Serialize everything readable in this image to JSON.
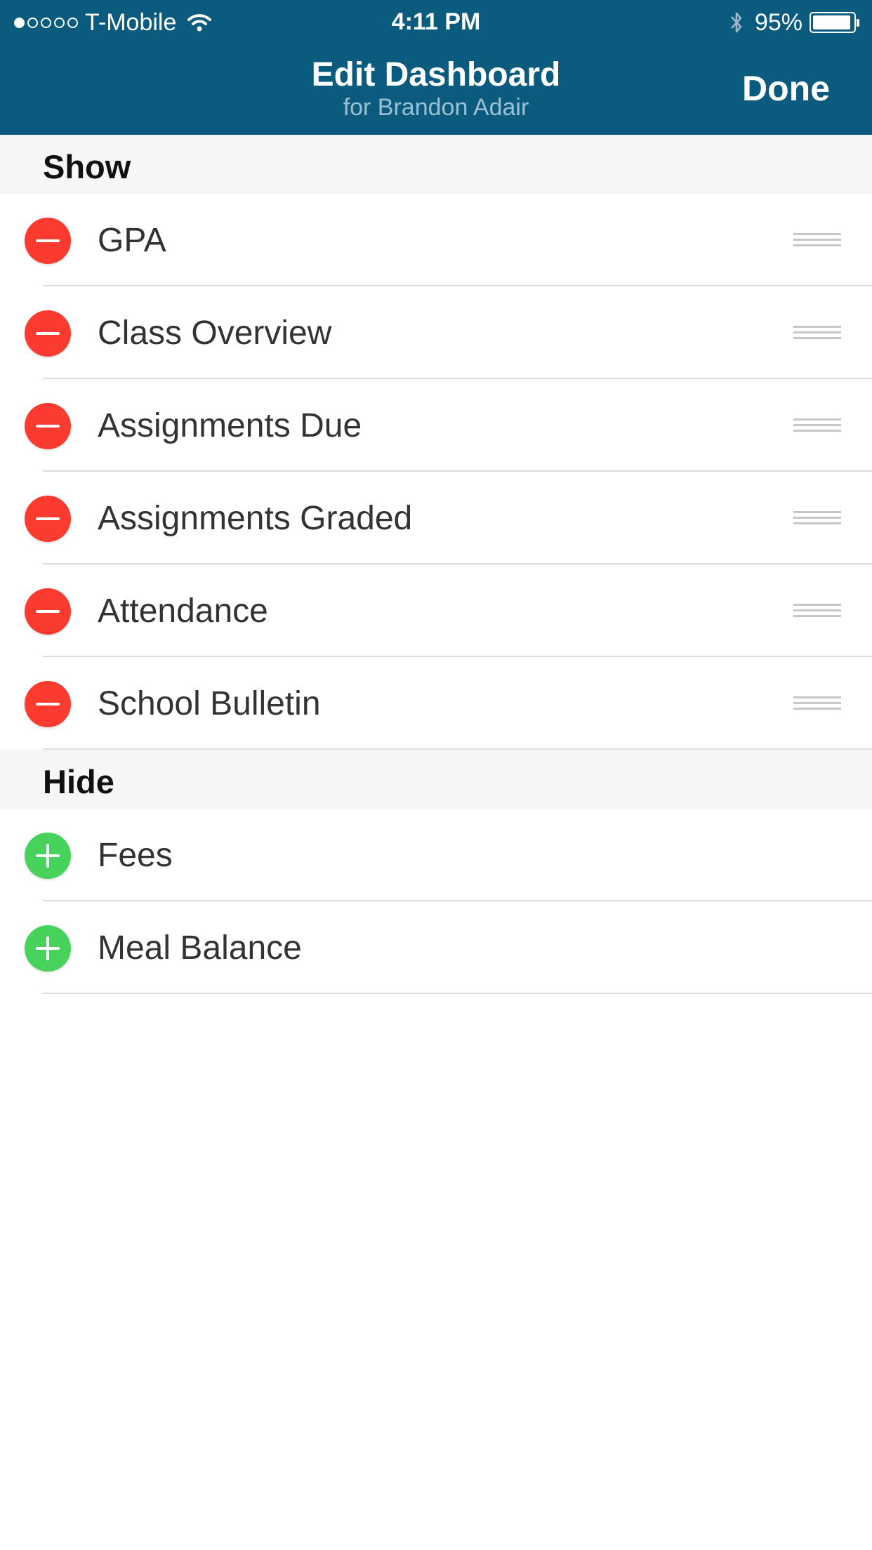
{
  "status_bar": {
    "signal_dots": [
      true,
      false,
      false,
      false,
      false
    ],
    "carrier": "T-Mobile",
    "wifi_icon": "wifi-icon",
    "time": "4:11 PM",
    "bluetooth_icon": "bluetooth-icon",
    "battery_percent": "95%",
    "battery_level": 0.95
  },
  "nav": {
    "title": "Edit Dashboard",
    "subtitle": "for Brandon Adair",
    "done_label": "Done"
  },
  "sections": {
    "show": {
      "title": "Show",
      "items": [
        "GPA",
        "Class Overview",
        "Assignments Due",
        "Assignments Graded",
        "Attendance",
        "School Bulletin"
      ]
    },
    "hide": {
      "title": "Hide",
      "items": [
        "Fees",
        "Meal Balance"
      ]
    }
  },
  "colors": {
    "nav_background": "#0a5b7e",
    "remove_button": "#fb3a30",
    "add_button": "#47d35b",
    "section_header_background": "#f6f6f6"
  }
}
